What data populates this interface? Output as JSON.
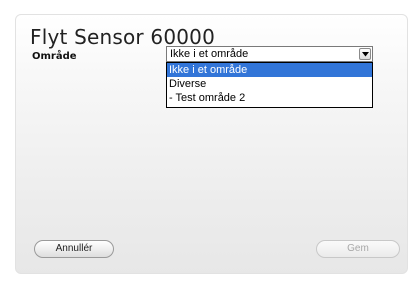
{
  "dialog": {
    "title": "Flyt Sensor 60000"
  },
  "form": {
    "area_label": "Område",
    "area_select": {
      "selected_value": "Ikke i et område",
      "options": [
        {
          "label": "Ikke i et område",
          "highlighted": true
        },
        {
          "label": "Diverse",
          "highlighted": false
        },
        {
          "label": "- Test område 2",
          "highlighted": false
        }
      ],
      "arrow_icon": "chevron-down-icon",
      "highlight_color": "#3275d8"
    }
  },
  "buttons": {
    "cancel_label": "Annullér",
    "save_label": "Gem",
    "save_enabled": false
  }
}
